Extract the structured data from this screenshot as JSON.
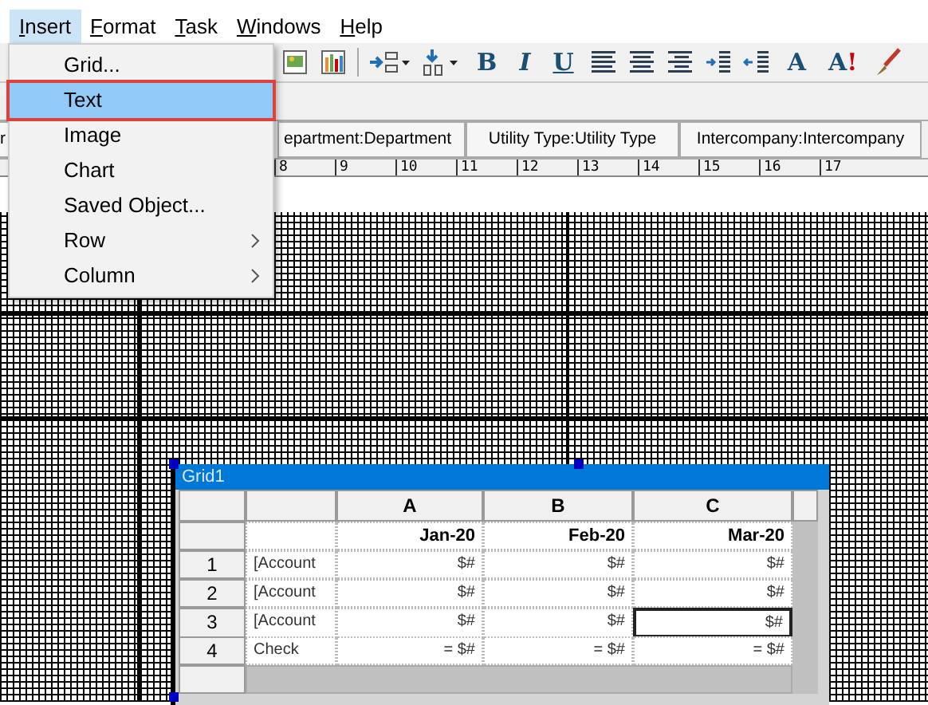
{
  "menu_bar": [
    {
      "label": "Insert",
      "selected": true
    },
    {
      "label": "Format",
      "selected": false
    },
    {
      "label": "Task",
      "selected": false
    },
    {
      "label": "Windows",
      "selected": false
    },
    {
      "label": "Help",
      "selected": false
    }
  ],
  "insert_menu": [
    {
      "label": "Grid...",
      "selected": false,
      "submenu": false
    },
    {
      "label": "Text",
      "selected": true,
      "submenu": false
    },
    {
      "label": "Image",
      "selected": false,
      "submenu": false
    },
    {
      "label": "Chart",
      "selected": false,
      "submenu": false
    },
    {
      "label": "Saved Object...",
      "selected": false,
      "submenu": false
    },
    {
      "label": "Row",
      "selected": false,
      "submenu": true
    },
    {
      "label": "Column",
      "selected": false,
      "submenu": true
    }
  ],
  "format_toolbar": {
    "bold": "B",
    "italic": "I",
    "underline": "U",
    "font": "A",
    "font_alert": {
      "letter": "A",
      "mark": "!"
    }
  },
  "dimension_bar": [
    "r",
    "epartment:Department",
    "Utility Type:Utility Type",
    "Intercompany:Intercompany"
  ],
  "ruler": [
    "8",
    "9",
    "10",
    "11",
    "12",
    "13",
    "14",
    "15",
    "16",
    "17"
  ],
  "grid": {
    "title": "Grid1",
    "columns": [
      "A",
      "B",
      "C"
    ],
    "header_row": [
      "Jan-20",
      "Feb-20",
      "Mar-20"
    ],
    "rows": [
      {
        "number": "1",
        "label": "[Account",
        "cells": [
          {
            "value": "$#",
            "selected": false
          },
          {
            "value": "$#",
            "selected": false
          },
          {
            "value": "$#",
            "selected": false
          }
        ]
      },
      {
        "number": "2",
        "label": "[Account",
        "cells": [
          {
            "value": "$#",
            "selected": false
          },
          {
            "value": "$#",
            "selected": false
          },
          {
            "value": "$#",
            "selected": false
          }
        ]
      },
      {
        "number": "3",
        "label": "[Account",
        "cells": [
          {
            "value": "$#",
            "selected": false
          },
          {
            "value": "$#",
            "selected": false
          },
          {
            "value": "$#",
            "selected": true
          }
        ]
      },
      {
        "number": "4",
        "label": "Check",
        "cells": [
          {
            "value": "= $#",
            "selected": false
          },
          {
            "value": "= $#",
            "selected": false
          },
          {
            "value": "= $#",
            "selected": false
          }
        ]
      }
    ]
  }
}
